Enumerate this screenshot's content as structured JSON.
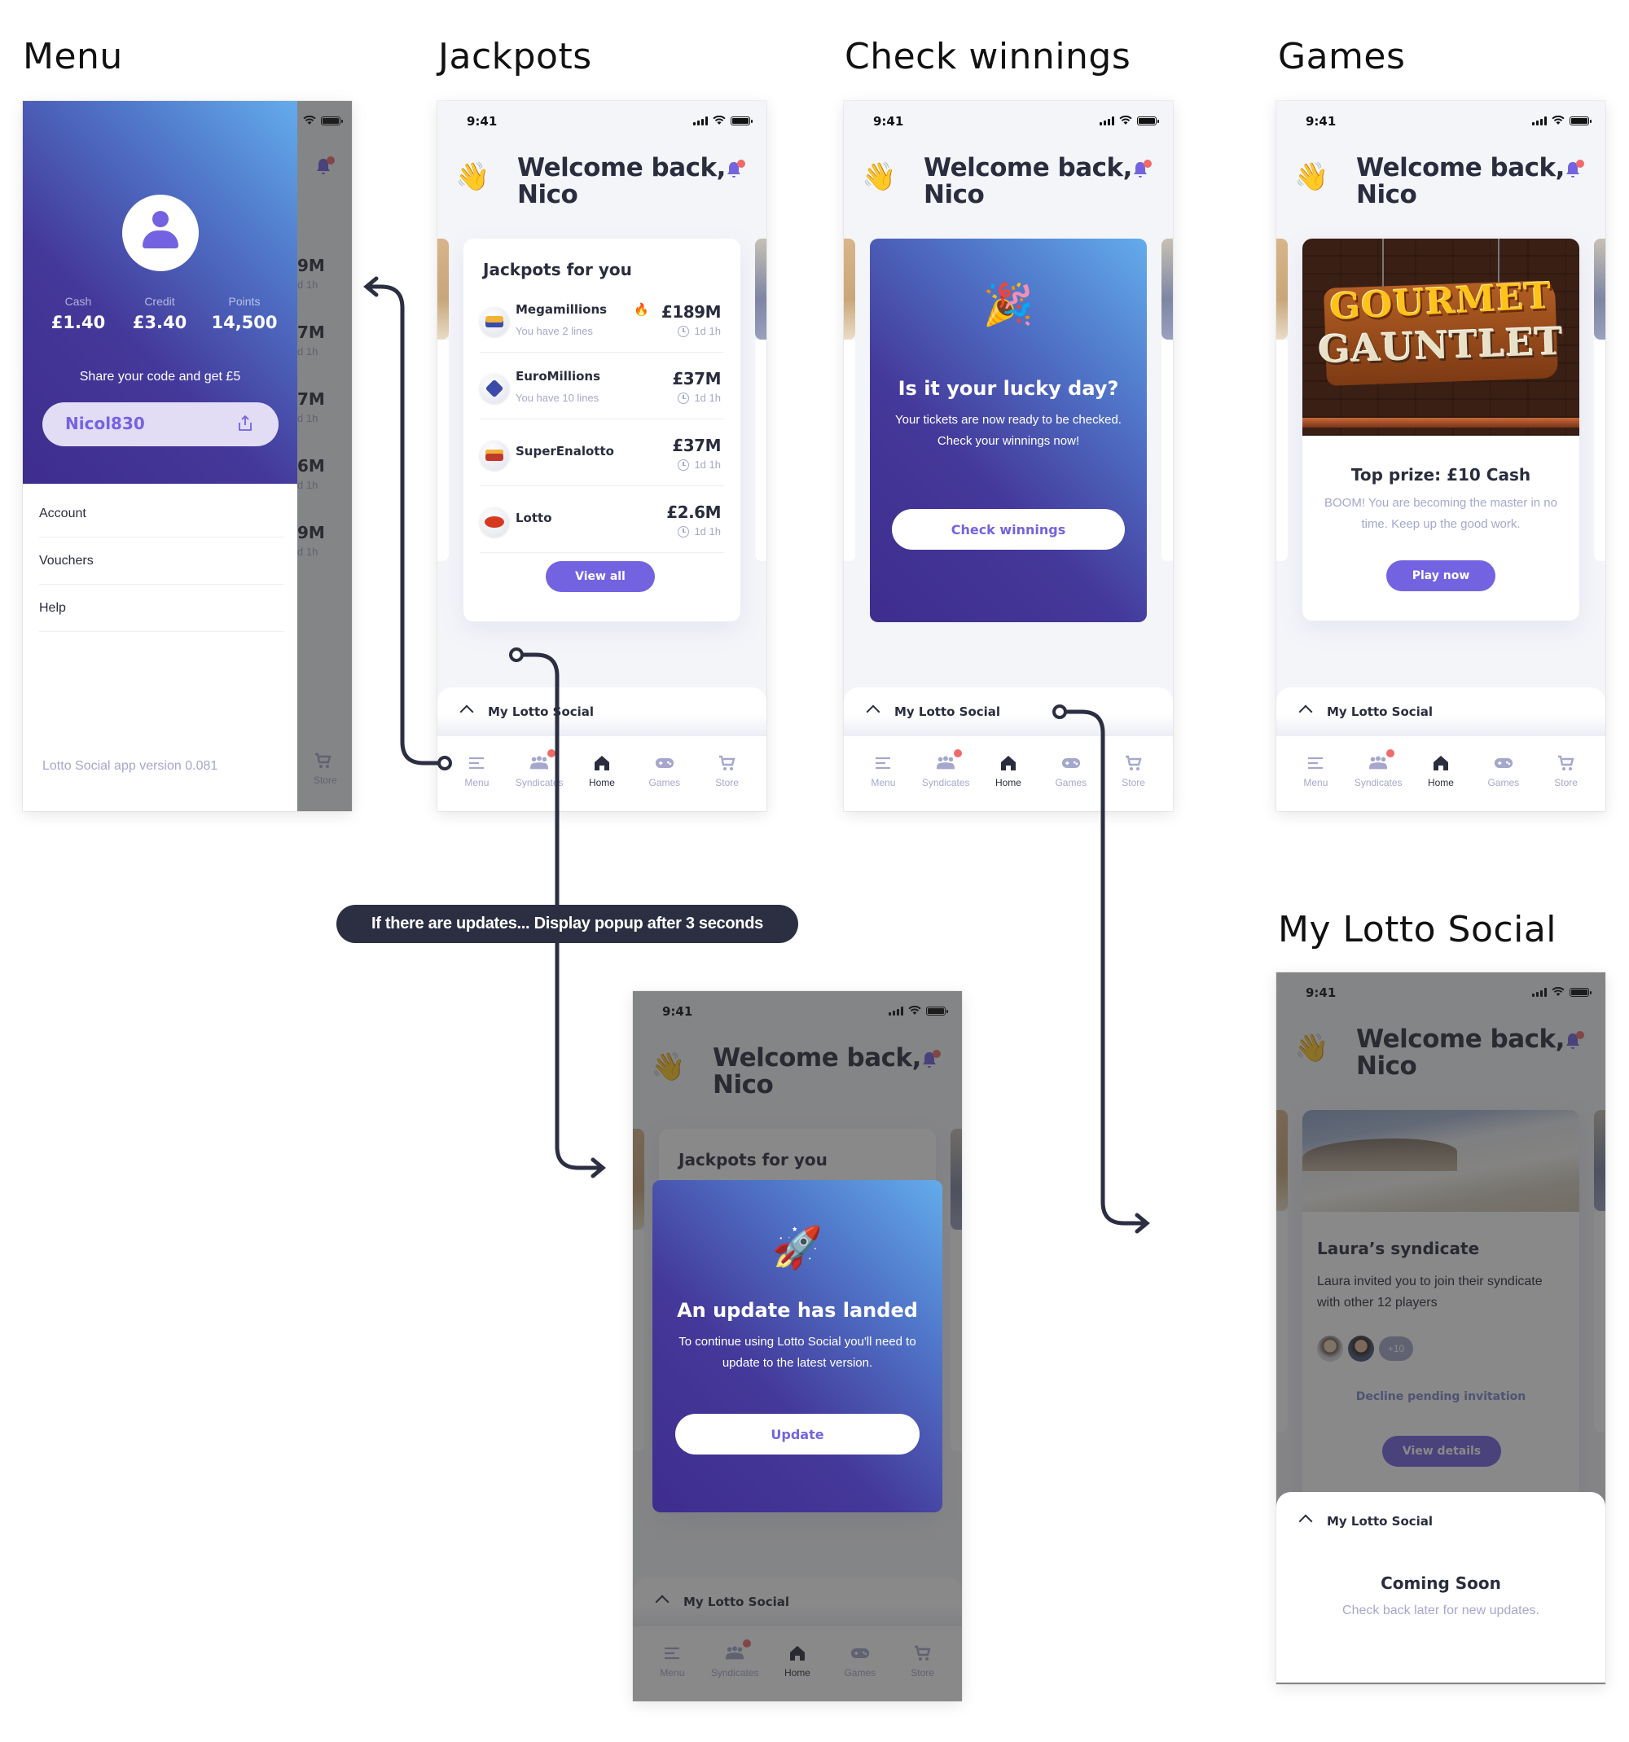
{
  "sections": {
    "menu": "Menu",
    "jackpots": "Jackpots",
    "check_winnings": "Check winnings",
    "games": "Games",
    "my_lotto_social": "My Lotto Social"
  },
  "status": {
    "time": "9:41"
  },
  "header": {
    "greeting": "Welcome back,",
    "name": "Nico",
    "wave_icon": "waving-hand-icon",
    "bell_icon": "bell-icon"
  },
  "menu": {
    "stats": [
      {
        "label": "Cash",
        "value": "£1.40"
      },
      {
        "label": "Credit",
        "value": "£3.40"
      },
      {
        "label": "Points",
        "value": "14,500"
      }
    ],
    "share_text": "Share your code and get £5",
    "code": "Nicol830",
    "items": [
      "Account",
      "Vouchers",
      "Help"
    ],
    "version": "Lotto Social app version 0.081",
    "peek_amounts": [
      "9M",
      "7M",
      "7M",
      "6M",
      "9M"
    ],
    "peek_time": "d 1h",
    "peek_tab": "Store"
  },
  "jackpots": {
    "title": "Jackpots for you",
    "rows": [
      {
        "name": "Megamillions",
        "lines": "You have 2 lines",
        "amount": "£189M",
        "time": "1d 1h",
        "hot": true,
        "logo_color": "#f2b23a"
      },
      {
        "name": "EuroMillions",
        "lines": "You have 10 lines",
        "amount": "£37M",
        "time": "1d 1h",
        "hot": false,
        "logo_color": "#3c4aa8"
      },
      {
        "name": "SuperEnalotto",
        "lines": "",
        "amount": "£37M",
        "time": "1d 1h",
        "hot": false,
        "logo_color": "#c0392b"
      },
      {
        "name": "Lotto",
        "lines": "",
        "amount": "£2.6M",
        "time": "1d 1h",
        "hot": false,
        "logo_color": "#d63a1e"
      }
    ],
    "view_all": "View all"
  },
  "check_winnings": {
    "emoji": "🎉",
    "title": "Is it your lucky day?",
    "body": "Your tickets are now ready to be checked. Check your winnings now!",
    "button": "Check winnings"
  },
  "games": {
    "game_title_line1": "GOURMET",
    "game_title_line2": "GAUNTLET",
    "prize": "Top prize: £10 Cash",
    "description": "BOOM! You are becoming the master in no time. Keep up the good work.",
    "button": "Play now"
  },
  "update_popup": {
    "emoji": "🚀",
    "title": "An update has landed",
    "body": "To continue using Lotto Social you'll need to update to the latest version.",
    "button": "Update",
    "behind_card_title": "Jackpots for you"
  },
  "syndicate": {
    "title": "Laura’s syndicate",
    "description": "Laura invited you to join their syndicate with other 12 players",
    "more_count": "+10",
    "decline": "Decline pending invitation",
    "view_details": "View details"
  },
  "bottom_sheet": {
    "label": "My Lotto Social",
    "coming_soon_title": "Coming Soon",
    "coming_soon_sub": "Check back later for new updates."
  },
  "tabs": [
    {
      "label": "Menu",
      "icon": "menu-icon",
      "active": false
    },
    {
      "label": "Syndicates",
      "icon": "syndicates-icon",
      "active": false,
      "badge": true
    },
    {
      "label": "Home",
      "icon": "home-icon",
      "active": true
    },
    {
      "label": "Games",
      "icon": "gamepad-icon",
      "active": false
    },
    {
      "label": "Store",
      "icon": "cart-icon",
      "active": false
    }
  ],
  "caption": "If there are updates... Display popup after 3 seconds",
  "colors": {
    "accent": "#7463e0",
    "dark": "#2a2d3e",
    "muted": "#a5a8cc",
    "badge": "#f06a6a",
    "gradient_start": "#3e2d8d",
    "gradient_end": "#63aceb"
  }
}
